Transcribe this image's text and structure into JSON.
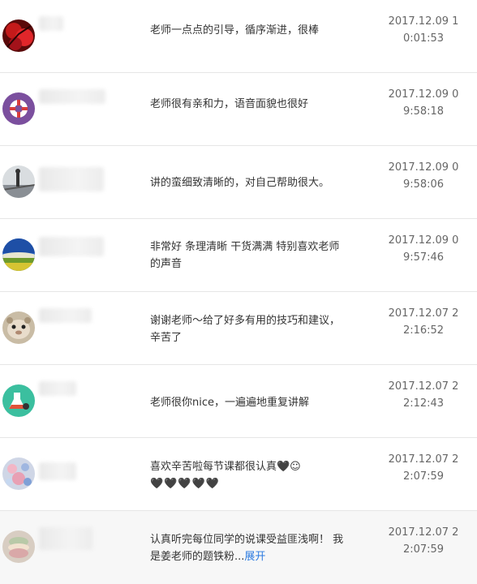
{
  "comments": [
    {
      "text": "老师一点点的引导，循序渐进，很棒",
      "time_line1": "2017.12.09 1",
      "time_line2": "0:01:53"
    },
    {
      "text": "老师很有亲和力，语音面貌也很好",
      "time_line1": "2017.12.09 0",
      "time_line2": "9:58:18"
    },
    {
      "text": "讲的蛮细致清晰的，对自己帮助很大。",
      "time_line1": "2017.12.09 0",
      "time_line2": "9:58:06"
    },
    {
      "text_line1": "非常好 条理清晰 干货满满 特别喜欢老师",
      "text_line2": "的声音",
      "time_line1": "2017.12.09 0",
      "time_line2": "9:57:46"
    },
    {
      "text_line1": "谢谢老师～给了好多有用的技巧和建议，",
      "text_line2": "辛苦了",
      "time_line1": "2017.12.07 2",
      "time_line2": "2:16:52"
    },
    {
      "text": "老师很你nice，一遍遍地重复讲解",
      "time_line1": "2017.12.07 2",
      "time_line2": "2:12:43"
    },
    {
      "text_line1": "喜欢辛苦啦每节课都很认真🖤☺",
      "text_line2": "🖤🖤🖤🖤🖤",
      "time_line1": "2017.12.07 2",
      "time_line2": "2:07:59"
    },
    {
      "text_line1": "认真听完每位同学的说课受益匪浅啊！ 我",
      "text_line2": "是姜老师的题铁粉...",
      "expand_label": "展开",
      "time_line1": "2017.12.07 2",
      "time_line2": "2:07:59"
    }
  ]
}
